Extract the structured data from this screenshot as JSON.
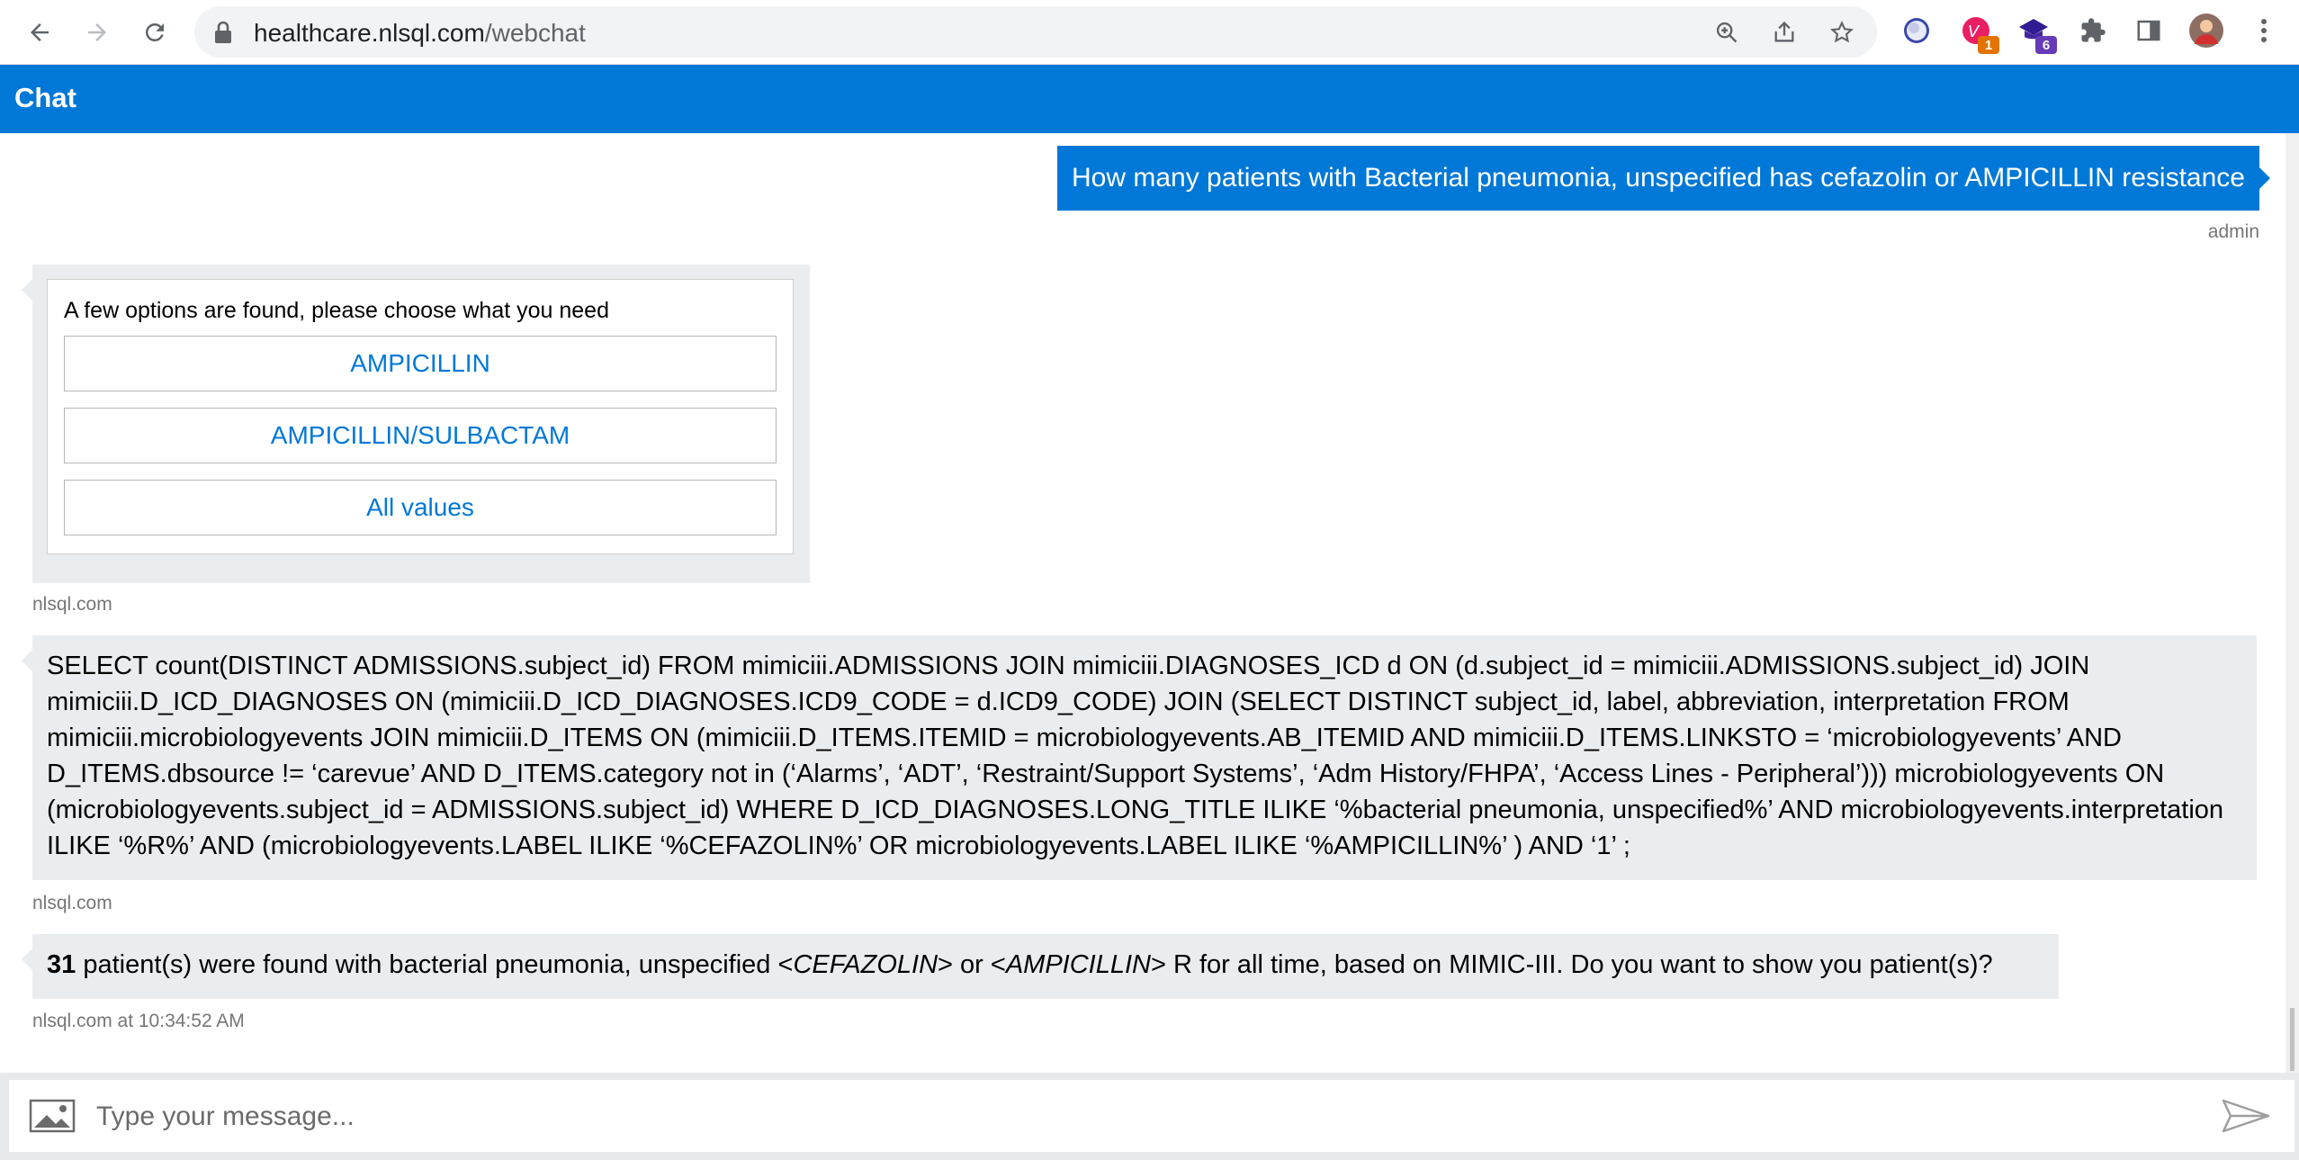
{
  "browser": {
    "url_host": "healthcare.nlsql.com",
    "url_path": "/webchat",
    "extensions": [
      {
        "name": "circle-extension-icon"
      },
      {
        "name": "gradient-extension-icon",
        "badge": "1",
        "badge_color": "#e37400"
      },
      {
        "name": "mortarboard-extension-icon",
        "badge": "6",
        "badge_color": "#673ab7"
      }
    ]
  },
  "header": {
    "title": "Chat"
  },
  "messages": {
    "user_question": "How many patients with Bacterial pneumonia, unspecified has cefazolin or AMPICILLIN resistance",
    "user_sender": "admin",
    "options_card": {
      "prompt": "A few options are found, please choose what you need",
      "options": [
        "AMPICILLIN",
        "AMPICILLIN/SULBACTAM",
        "All values"
      ],
      "sender": "nlsql.com"
    },
    "sql": {
      "text": "SELECT count(DISTINCT ADMISSIONS.subject_id) FROM mimiciii.ADMISSIONS JOIN mimiciii.DIAGNOSES_ICD d ON (d.subject_id = mimiciii.ADMISSIONS.subject_id) JOIN mimiciii.D_ICD_DIAGNOSES ON (mimiciii.D_ICD_DIAGNOSES.ICD9_CODE = d.ICD9_CODE) JOIN (SELECT DISTINCT subject_id, label, abbreviation, interpretation FROM mimiciii.microbiologyevents JOIN mimiciii.D_ITEMS ON (mimiciii.D_ITEMS.ITEMID = microbiologyevents.AB_ITEMID AND mimiciii.D_ITEMS.LINKSTO = ‘microbiologyevents’ AND D_ITEMS.dbsource != ‘carevue’ AND D_ITEMS.category not in (‘Alarms’, ‘ADT’, ‘Restraint/Support Systems’, ‘Adm History/FHPA’, ‘Access Lines - Peripheral’))) microbiologyevents ON (microbiologyevents.subject_id = ADMISSIONS.subject_id) WHERE D_ICD_DIAGNOSES.LONG_TITLE ILIKE ‘%bacterial pneumonia, unspecified%’ AND microbiologyevents.interpretation ILIKE ‘%R%’ AND (microbiologyevents.LABEL ILIKE ‘%CEFAZOLIN%’ OR microbiologyevents.LABEL ILIKE ‘%AMPICILLIN%’ ) AND ‘1’ ;",
      "sender": "nlsql.com"
    },
    "answer": {
      "count": "31",
      "part1": " patient(s) were found with bacterial pneumonia, unspecified ",
      "lt1": "<",
      "term1": "CEFAZOLIN",
      "gt1": ">",
      "mid": " or ",
      "lt2": "<",
      "term2": "AMPICILLIN",
      "gt2": ">",
      "part2": " R for all time, based on MIMIC-III. Do you want to show you patient(s)?",
      "sender": "nlsql.com at 10:34:52 AM"
    }
  },
  "input": {
    "placeholder": "Type your message..."
  },
  "colors": {
    "accent": "#0078d7",
    "bot_bubble": "#eaedef"
  }
}
